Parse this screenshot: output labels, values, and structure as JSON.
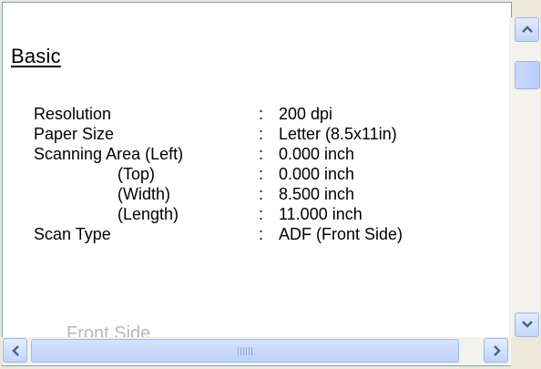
{
  "section": {
    "title": "Basic"
  },
  "rows": [
    {
      "label": "Resolution",
      "colon": ":",
      "value": "200 dpi"
    },
    {
      "label": "Paper Size",
      "colon": ":",
      "value": "Letter (8.5x11in)"
    },
    {
      "label": "Scanning Area (Left)",
      "colon": ":",
      "value": "0.000 inch"
    },
    {
      "label": "(Top)",
      "colon": ":",
      "value": "0.000 inch"
    },
    {
      "label": "(Width)",
      "colon": ":",
      "value": "8.500 inch"
    },
    {
      "label": "(Length)",
      "colon": ":",
      "value": "11.000 inch"
    },
    {
      "label": "Scan Type",
      "colon": ":",
      "value": "ADF (Front Side)"
    }
  ],
  "partial_heading": "Front Side",
  "scrollbars": {
    "up_icon": "arrow-up-icon",
    "down_icon": "arrow-down-icon",
    "left_icon": "arrow-left-icon",
    "right_icon": "arrow-right-icon"
  }
}
